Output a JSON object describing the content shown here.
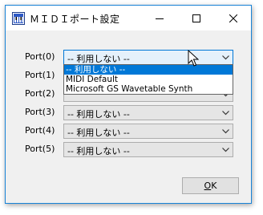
{
  "window": {
    "title": "ＭＩＤＩポート設定",
    "icon": "midi-keyboard-icon"
  },
  "titlebar_buttons": [
    "minimize-icon",
    "maximize-icon",
    "close-icon"
  ],
  "ports": [
    {
      "label": "Port(0)",
      "value": "-- 利用しない --"
    },
    {
      "label": "Port(1)",
      "value": ""
    },
    {
      "label": "Port(2)",
      "value": ""
    },
    {
      "label": "Port(3)",
      "value": "-- 利用しない --"
    },
    {
      "label": "Port(4)",
      "value": "-- 利用しない --"
    },
    {
      "label": "Port(5)",
      "value": "-- 利用しない --"
    }
  ],
  "dropdown": {
    "options": [
      "-- 利用しない --",
      "MIDI Default",
      "Microsoft GS Wavetable Synth"
    ],
    "selected_index": 0
  },
  "ok_button": {
    "label_mnemonic": "O",
    "label_rest": "K"
  },
  "colors": {
    "accent": "#0078d7",
    "window_border": "#1883d7",
    "face": "#f0f0f0"
  }
}
